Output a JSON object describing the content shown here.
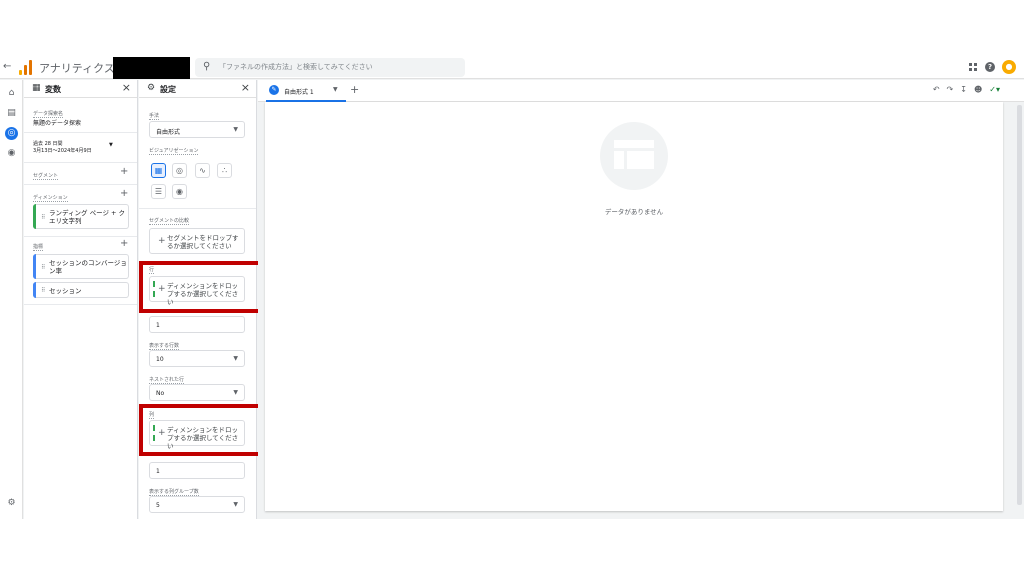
{
  "header": {
    "app_title": "アナリティクス",
    "search_placeholder": "「ファネルの作成方法」と検索してみてください"
  },
  "variables_panel": {
    "title": "変数",
    "exploration_name_label": "データ探索名",
    "exploration_name": "無題のデータ探索",
    "date_range_label": "過去 28 日間",
    "date_range_value": "3月13日～2024年4月9日",
    "segments_label": "セグメント",
    "dimensions_label": "ディメンション",
    "dimension_item": "ランディング ページ + クエリ文字列",
    "metrics_label": "指標",
    "metric_items": [
      "セッションのコンバージョン率",
      "セッション"
    ]
  },
  "settings_panel": {
    "title": "設定",
    "technique_label": "手法",
    "technique_value": "自由形式",
    "visualization_label": "ビジュアリゼーション",
    "segment_compare_label": "セグメントの比較",
    "segment_drop_text": "セグメントをドロップするか選択してください",
    "rows_label": "行",
    "rows_drop_text": "ディメンションをドロップするか選択してください",
    "start_row_value": "1",
    "rows_to_show_label": "表示する行数",
    "rows_to_show_value": "10",
    "nested_rows_label": "ネストされた行",
    "nested_rows_value": "No",
    "columns_label": "列",
    "columns_drop_text": "ディメンションをドロップするか選択してください",
    "start_col_value": "1",
    "col_groups_label": "表示する列グループ数",
    "col_groups_value": "5"
  },
  "canvas": {
    "tab_label": "自由形式 1",
    "empty_text": "データがありません"
  },
  "colors": {
    "accent": "#1a73e8",
    "dimension_green": "#34a853",
    "metric_blue": "#4285f4",
    "highlight_red": "#c00000"
  }
}
